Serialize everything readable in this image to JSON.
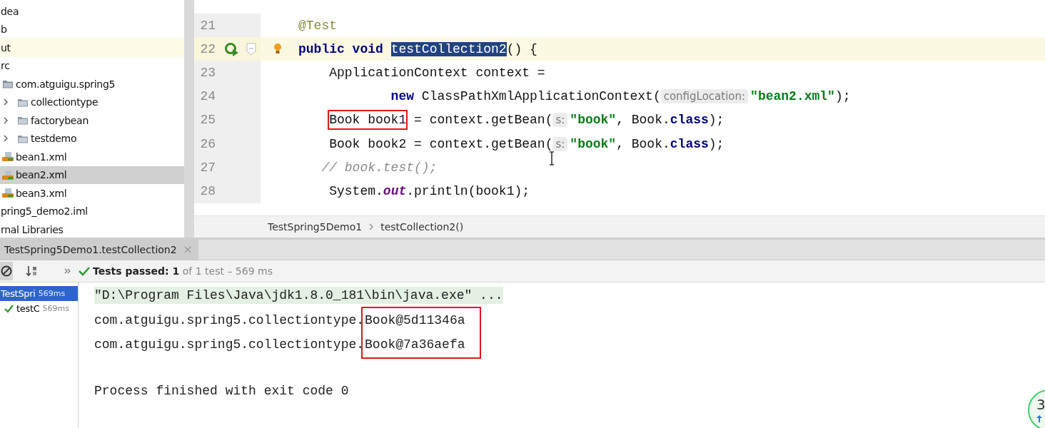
{
  "project_tree": {
    "items": [
      {
        "text": "dea"
      },
      {
        "text": "b"
      },
      {
        "text": "ut",
        "current_line": true
      },
      {
        "text": "rc",
        "children": [
          {
            "text": "com.atguigu.spring5",
            "kind": "package",
            "children": [
              {
                "text": "collectiontype",
                "kind": "folder",
                "expanded": false
              },
              {
                "text": "factorybean",
                "kind": "folder",
                "expanded": false
              },
              {
                "text": "testdemo",
                "kind": "folder",
                "expanded": false
              }
            ]
          },
          {
            "text": "bean1.xml",
            "kind": "xml",
            "selected": false
          },
          {
            "text": "bean2.xml",
            "kind": "xml",
            "selected": true
          },
          {
            "text": "bean3.xml",
            "kind": "xml",
            "selected": false
          }
        ]
      },
      {
        "text": "pring5_demo2.iml"
      },
      {
        "text": "rnal Libraries"
      }
    ]
  },
  "editor": {
    "lines": [
      {
        "number": "21",
        "current": false,
        "tokens": [
          {
            "kind": "annotation",
            "text": "@Test"
          }
        ]
      },
      {
        "number": "22",
        "current": true,
        "markers": [
          {
            "kind": "run"
          },
          {
            "kind": "fold"
          },
          {
            "kind": "bulb"
          }
        ],
        "tokens": [
          {
            "kind": "keyword",
            "text": "public void "
          },
          {
            "kind": "selected",
            "text": "testCollection2"
          },
          {
            "kind": "plain",
            "text": "() {"
          }
        ],
        "children": [
          {
            "number": "23",
            "current": false,
            "tokens": [
              {
                "kind": "plain",
                "text": "ApplicationContext context ="
              }
            ],
            "children": [
              {
                "number": "24",
                "current": false,
                "kind": "continuation",
                "tokens": [
                  {
                    "kind": "keyword",
                    "text": "new "
                  },
                  {
                    "kind": "plain",
                    "text": "ClassPathXmlApplicationContext("
                  },
                  {
                    "kind": "hint",
                    "text": "configLocation:"
                  },
                  {
                    "kind": "string",
                    "text": "\"bean2.xml\""
                  },
                  {
                    "kind": "plain",
                    "text": ");"
                  }
                ]
              }
            ]
          },
          {
            "number": "25",
            "current": false,
            "tokens": [
              {
                "kind": "plain",
                "text": "Book book1",
                "boxed": true
              },
              {
                "kind": "plain",
                "text": " = context.getBean("
              },
              {
                "kind": "hint",
                "text": "s:"
              },
              {
                "kind": "string",
                "text": "\"book\""
              },
              {
                "kind": "plain",
                "text": ", Book."
              },
              {
                "kind": "keyword",
                "text": "class"
              },
              {
                "kind": "plain",
                "text": ");"
              }
            ]
          },
          {
            "number": "26",
            "current": false,
            "tokens": [
              {
                "kind": "plain",
                "text": "Book book2 = context.getBean("
              },
              {
                "kind": "hint",
                "text": "s:"
              },
              {
                "kind": "string",
                "text": "\"book\""
              },
              {
                "kind": "plain",
                "text": ", Book."
              },
              {
                "kind": "keyword",
                "text": "class"
              },
              {
                "kind": "plain",
                "text": ");"
              }
            ]
          },
          {
            "number": "27",
            "current": false,
            "tokens": [
              {
                "kind": "comment",
                "text": "// book.test();"
              }
            ]
          },
          {
            "number": "28",
            "current": false,
            "tokens": [
              {
                "kind": "plain",
                "text": "System."
              },
              {
                "kind": "static",
                "text": "out"
              },
              {
                "kind": "plain",
                "text": ".println(book1);"
              }
            ]
          }
        ]
      }
    ]
  },
  "breadcrumbs": [
    "TestSpring5Demo1",
    "testCollection2()"
  ],
  "run_panel": {
    "tab": {
      "title": "TestSpring5Demo1.testCollection2",
      "selected": true
    },
    "status": "**Tests passed: 1** of 1 test – 569 ms",
    "test_tree": [
      {
        "name": "TestSpri",
        "time": "569ms",
        "selected": true,
        "children": [
          {
            "name": "testC",
            "time": "569ms",
            "selected": false,
            "passed": true
          }
        ]
      }
    ],
    "console": {
      "command": "\"D:\\Program Files\\Java\\jdk1.8.0_181\\bin\\java.exe\" ...",
      "output": [
        {
          "prefix": "com.atguigu.spring5.collectiontype.",
          "value": "Book@5d11346a"
        },
        {
          "prefix": "com.atguigu.spring5.collectiontype.",
          "value": "Book@7a36aefa"
        }
      ],
      "exit_message": "Process finished with exit code 0"
    }
  },
  "floating_widget": {
    "text": "3"
  }
}
